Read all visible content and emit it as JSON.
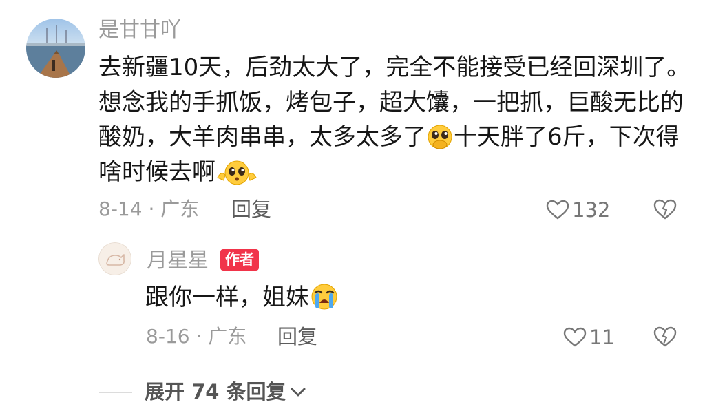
{
  "comment": {
    "username": "是甘甘吖",
    "text_segments": [
      "去新疆10天，后劲太大了，完全不能接受已经回深圳了。想念我的手抓饭，烤包子，超大馕，一把抓，巨酸无比的酸奶，大羊肉串串，太多太多了",
      "十天胖了6斤，下次得啥时候去啊"
    ],
    "date_location": "8-14 · 广东",
    "reply_label": "回复",
    "like_count": "132",
    "avatar_icon": "harbor-photo-avatar",
    "emoji_1": "pleading-hands-over-mouth-emoji",
    "emoji_2": "pleading-face-emoji"
  },
  "reply": {
    "username": "月星星",
    "author_badge": "作者",
    "text": "跟你一样，姐妹",
    "date_location": "8-16 · 广东",
    "reply_label": "回复",
    "like_count": "11",
    "avatar_icon": "sketch-cat-avatar",
    "emoji": "loudly-crying-emoji"
  },
  "expand_label": "展开 74 条回复",
  "icons": {
    "like": "heart-outline-icon",
    "dislike": "broken-heart-icon",
    "expand": "chevron-down-icon"
  },
  "colors": {
    "badge": "#f1344a",
    "secondary_text": "#9a9a9a",
    "primary_text": "#161616"
  }
}
